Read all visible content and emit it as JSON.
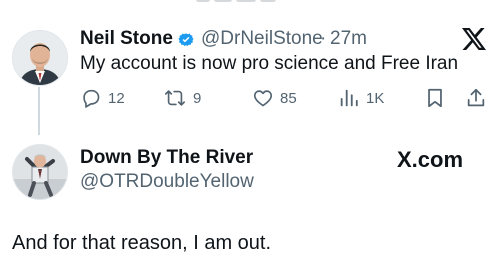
{
  "reply": {
    "author_name": "Neil Stone",
    "author_handle": "@DrNeilStone",
    "separator": "·",
    "time": "27m",
    "text": "My account is now pro science and Free Iran",
    "stats": {
      "replies": "12",
      "reposts": "9",
      "likes": "85",
      "views": "1K"
    },
    "verified": true
  },
  "post": {
    "author_name": "Down By The River",
    "author_handle": "@OTRDoubleYellow",
    "brand": "X.com",
    "text": "And for that reason, I am out."
  },
  "colors": {
    "text": "#0f1419",
    "muted": "#536471",
    "verified_blue": "#1d9bf0",
    "thread_line": "#cfd9de"
  },
  "icons": {
    "reply": "reply-icon",
    "repost": "repost-icon",
    "like": "like-icon",
    "views": "views-icon",
    "bookmark": "bookmark-icon",
    "share": "share-icon",
    "x_logo": "x-logo-icon",
    "verified": "verified-badge-icon"
  }
}
